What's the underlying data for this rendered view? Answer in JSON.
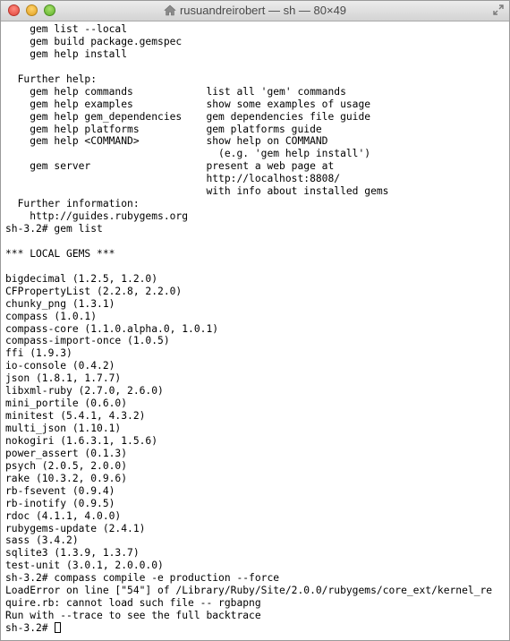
{
  "window": {
    "title": "rusuandreirobert — sh — 80×49"
  },
  "terminal": {
    "lines": [
      "    gem list --local",
      "    gem build package.gemspec",
      "    gem help install",
      "",
      "  Further help:",
      "    gem help commands            list all 'gem' commands",
      "    gem help examples            show some examples of usage",
      "    gem help gem_dependencies    gem dependencies file guide",
      "    gem help platforms           gem platforms guide",
      "    gem help <COMMAND>           show help on COMMAND",
      "                                   (e.g. 'gem help install')",
      "    gem server                   present a web page at",
      "                                 http://localhost:8808/",
      "                                 with info about installed gems",
      "  Further information:",
      "    http://guides.rubygems.org",
      "sh-3.2# gem list",
      "",
      "*** LOCAL GEMS ***",
      "",
      "bigdecimal (1.2.5, 1.2.0)",
      "CFPropertyList (2.2.8, 2.2.0)",
      "chunky_png (1.3.1)",
      "compass (1.0.1)",
      "compass-core (1.1.0.alpha.0, 1.0.1)",
      "compass-import-once (1.0.5)",
      "ffi (1.9.3)",
      "io-console (0.4.2)",
      "json (1.8.1, 1.7.7)",
      "libxml-ruby (2.7.0, 2.6.0)",
      "mini_portile (0.6.0)",
      "minitest (5.4.1, 4.3.2)",
      "multi_json (1.10.1)",
      "nokogiri (1.6.3.1, 1.5.6)",
      "power_assert (0.1.3)",
      "psych (2.0.5, 2.0.0)",
      "rake (10.3.2, 0.9.6)",
      "rb-fsevent (0.9.4)",
      "rb-inotify (0.9.5)",
      "rdoc (4.1.1, 4.0.0)",
      "rubygems-update (2.4.1)",
      "sass (3.4.2)",
      "sqlite3 (1.3.9, 1.3.7)",
      "test-unit (3.0.1, 2.0.0.0)",
      "sh-3.2# compass compile -e production --force",
      "LoadError on line [\"54\"] of /Library/Ruby/Site/2.0.0/rubygems/core_ext/kernel_re",
      "quire.rb: cannot load such file -- rgbapng",
      "Run with --trace to see the full backtrace"
    ],
    "prompt": "sh-3.2# "
  }
}
